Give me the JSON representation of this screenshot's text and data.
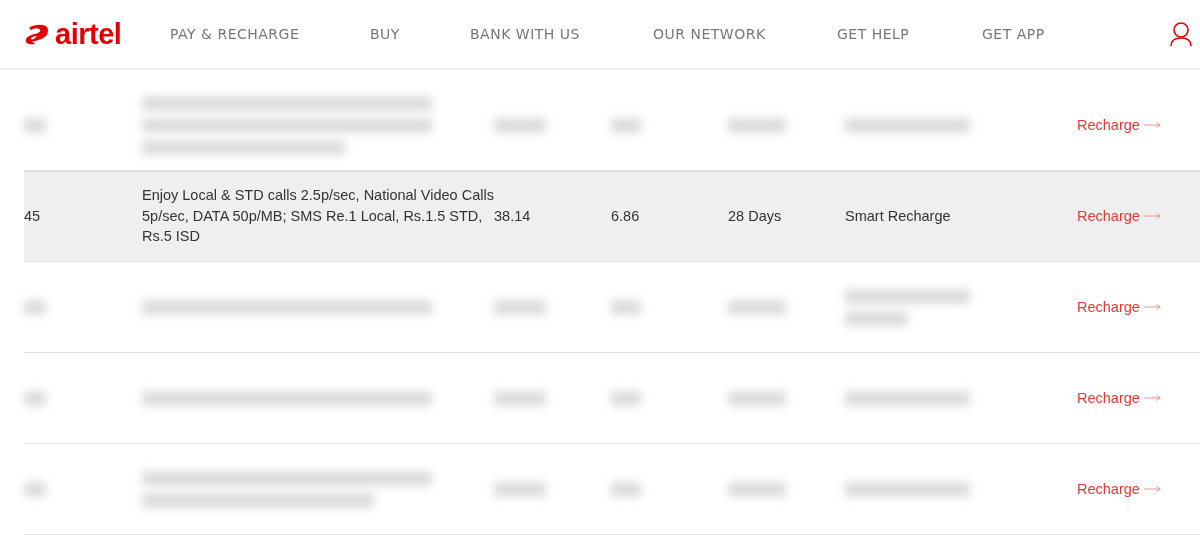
{
  "header": {
    "logo": "airtel",
    "nav": [
      {
        "label": "PAY & RECHARGE"
      },
      {
        "label": "BUY"
      },
      {
        "label": "BANK WITH US"
      },
      {
        "label": "OUR NETWORK"
      },
      {
        "label": "GET HELP"
      },
      {
        "label": "GET APP"
      }
    ]
  },
  "table": {
    "rows": [
      {
        "kind": "blurred",
        "selected": false,
        "action": "Recharge"
      },
      {
        "kind": "plan",
        "selected": true,
        "cells": [
          "45",
          "Enjoy Local & STD calls 2.5p/sec, National Video Calls 5p/sec, DATA 50p/MB; SMS Re.1 Local, Rs.1.5 STD, Rs.5 ISD",
          "38.14",
          "6.86",
          "28 Days",
          "Smart Recharge"
        ],
        "action": "Recharge"
      },
      {
        "kind": "blurred",
        "selected": false,
        "action": "Recharge"
      },
      {
        "kind": "blurred",
        "selected": false,
        "action": "Recharge"
      },
      {
        "kind": "blurred",
        "selected": false,
        "action": "Recharge"
      }
    ]
  }
}
